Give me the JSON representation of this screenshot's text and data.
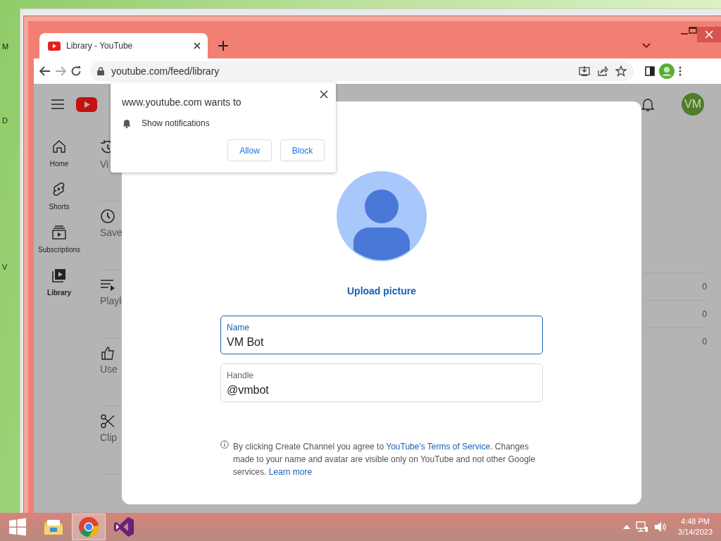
{
  "desktop_labels": [
    "M",
    "D",
    "V"
  ],
  "browser": {
    "tab": {
      "title": "Library - YouTube",
      "selected": true
    },
    "address": "youtube.com/feed/library"
  },
  "youtube": {
    "account_initials": "VM",
    "guide": [
      {
        "label": "Home",
        "selected": false
      },
      {
        "label": "Shorts",
        "selected": false
      },
      {
        "label": "Subscriptions",
        "selected": false
      },
      {
        "label": "Library",
        "selected": true
      }
    ],
    "library_sections": [
      "Vi",
      "Save",
      "Playl",
      "Use",
      "Clip"
    ],
    "counts": [
      "0",
      "0",
      "0"
    ]
  },
  "create_channel_dialog": {
    "upload_label": "Upload picture",
    "fields": [
      {
        "label": "Name",
        "value": "VM Bot",
        "focused": true
      },
      {
        "label": "Handle",
        "value": "@vmbot",
        "focused": false
      }
    ],
    "notice": {
      "text_before": "By clicking Create Channel you agree to ",
      "terms_link": "YouTube's Terms of Service",
      "text_middle": ". Changes made to your name and avatar are visible only on YouTube and not other Google services. ",
      "learn_more": "Learn more"
    }
  },
  "permission_popup": {
    "title": "www.youtube.com wants to",
    "permission": "Show notifications",
    "buttons": [
      "Allow",
      "Block"
    ]
  },
  "taskbar": {
    "apps": [
      {
        "kind": "explorer",
        "active": false
      },
      {
        "kind": "chrome",
        "active": true
      },
      {
        "kind": "visual-studio",
        "active": false
      }
    ],
    "time": "4:48 PM",
    "date": "3/14/2023"
  }
}
